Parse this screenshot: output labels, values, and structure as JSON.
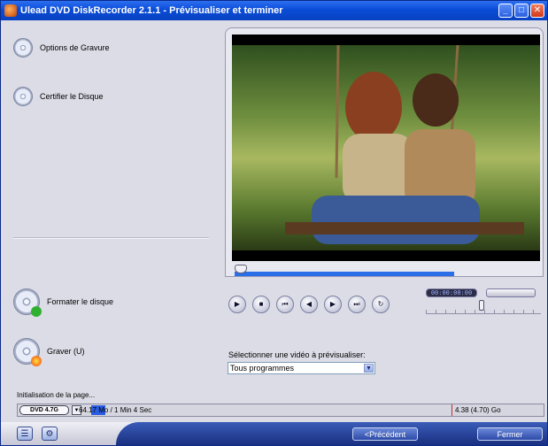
{
  "window": {
    "title": "Ulead DVD DiskRecorder 2.1.1 - Prévisualiser et terminer",
    "minimize_glyph": "_",
    "maximize_glyph": "□",
    "close_glyph": "✕"
  },
  "left_panel": {
    "items": [
      {
        "label": "Options de Gravure",
        "icon": "disc-settings-icon"
      },
      {
        "label": "Certifier le Disque",
        "icon": "disc-search-icon"
      },
      {
        "label": "Formater le disque",
        "icon": "disc-format-icon"
      },
      {
        "label": "Graver (U)",
        "icon": "disc-burn-icon"
      }
    ]
  },
  "player": {
    "progress_fraction": 0.72,
    "controls": [
      {
        "name": "play-button",
        "glyph": "▶"
      },
      {
        "name": "stop-button",
        "glyph": "■"
      },
      {
        "name": "skip-start-button",
        "glyph": "⏮"
      },
      {
        "name": "step-back-button",
        "glyph": "◀"
      },
      {
        "name": "step-forward-button",
        "glyph": "▶"
      },
      {
        "name": "skip-end-button",
        "glyph": "⏭"
      },
      {
        "name": "repeat-button",
        "glyph": "↻"
      }
    ],
    "timecode": "00:00:00:00"
  },
  "preview_select": {
    "label": "Sélectionner une vidéo à prévisualiser:",
    "value": "Tous programmes",
    "arrow": "▼"
  },
  "status": {
    "text": "Initialisation de la page..."
  },
  "capacity": {
    "disc_type": "DVD 4.7G",
    "arrow": "▼",
    "used_text": "64.17 Mo / 1 Min 4 Sec",
    "remaining_text": "4.38 (4.70) Go",
    "used_fraction": 0.027
  },
  "footer": {
    "previous_label": "<Précédent",
    "close_label": "Fermer",
    "help_glyph": "☰",
    "settings_glyph": "⚙"
  },
  "colors": {
    "titlebar": "#0a4cd8",
    "progress": "#2a6ee8",
    "button": "#2d4aa8"
  }
}
